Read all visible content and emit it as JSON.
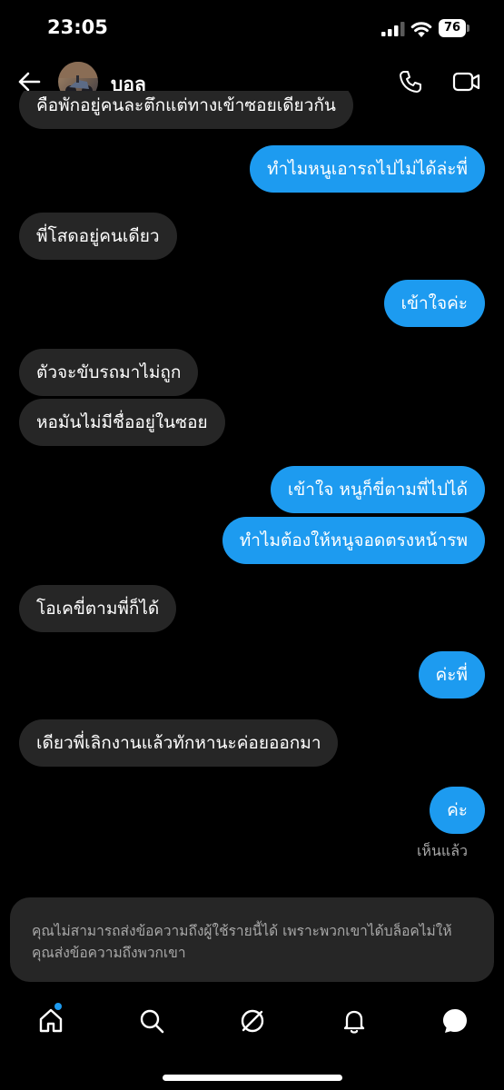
{
  "status_bar": {
    "time": "23:05",
    "battery_level": "76",
    "icons": [
      "signal-icon",
      "wifi-icon",
      "battery-icon"
    ]
  },
  "header": {
    "contact_name": "บอล",
    "icons": [
      "back-arrow-icon",
      "avatar",
      "phone-icon",
      "video-icon"
    ]
  },
  "messages": [
    {
      "side": "in",
      "text": "คือพักอยู่คนละตึกแต่ทางเข้าซอยเดียวกัน"
    },
    {
      "side": "out",
      "text": "ทำไมหนูเอารถไปไม่ได้ล่ะพี่"
    },
    {
      "side": "in",
      "text": "พี่โสดอยู่คนเดียว"
    },
    {
      "side": "out",
      "text": "เข้าใจค่ะ"
    },
    {
      "side": "in",
      "text": "ตัวจะขับรถมาไม่ถูก"
    },
    {
      "side": "in",
      "text": "หอมันไม่มีชื่ออยู่ในซอย"
    },
    {
      "side": "out",
      "text": "เข้าใจ หนูก็ขี่ตามพี่ไปได้"
    },
    {
      "side": "out",
      "text": "ทำไมต้องให้หนูจอดตรงหน้ารพ"
    },
    {
      "side": "in",
      "text": "โอเคขี่ตามพี่ก็ได้"
    },
    {
      "side": "out",
      "text": "ค่ะพี่"
    },
    {
      "side": "in",
      "text": "เดียวพี่เลิกงานแล้วทักหานะค่อยออกมา"
    },
    {
      "side": "out",
      "text": "ค่ะ"
    }
  ],
  "seen_label": "เห็นแล้ว",
  "blocked_notice": "คุณไม่สามารถส่งข้อความถึงผู้ใช้รายนี้ได้ เพราะพวกเขาได้บล็อคไม่ให้คุณส่งข้อความถึงพวกเขา",
  "tab_bar": {
    "tabs": [
      "home-icon",
      "search-icon",
      "explore-icon",
      "bell-icon",
      "messenger-icon"
    ],
    "home_has_notification": true
  },
  "colors": {
    "background": "#000000",
    "incoming_bubble": "#262626",
    "outgoing_bubble": "#1d9bf0",
    "muted_text": "#a8a8a8"
  }
}
